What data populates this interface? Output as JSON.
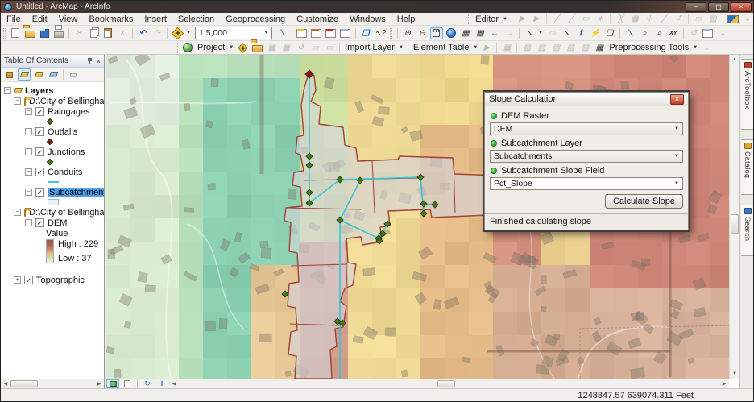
{
  "window": {
    "title": "Untitled - ArcMap - ArcInfo"
  },
  "menus": [
    "File",
    "Edit",
    "View",
    "Bookmarks",
    "Insert",
    "Selection",
    "Geoprocessing",
    "Customize",
    "Windows",
    "Help"
  ],
  "toolbars": {
    "scale": "1:5,000",
    "editor_label": "Editor",
    "project_label": "Project",
    "import_layer_label": "Import Layer",
    "element_table_label": "Element Table",
    "preprocessing_label": "Preprocessing Tools"
  },
  "icons": {
    "dropdown": "▼",
    "cut": "✂",
    "delete": "×",
    "undo": "↶",
    "redo": "↷",
    "zoom_in": "⊕",
    "zoom_out": "⊖",
    "back": "←",
    "forward": "→",
    "identify": "ℹ",
    "refresh": "↻",
    "pause": "‖",
    "play": "▶",
    "up": "▲",
    "down": "▼",
    "left": "◀",
    "right": "▶",
    "minimize": "–",
    "maximize": "▢",
    "close": "×",
    "select": "↖",
    "whats_this": "↖?",
    "asterisk": "∗",
    "sketch": "╱",
    "grid": "▦",
    "chart": "▨",
    "box": "▭",
    "rotate": "↺",
    "split": "╳",
    "move": "⊹",
    "xy": "XY",
    "find": "⌕",
    "measure": "⟍",
    "flash": "⚡",
    "bubble": "❑",
    "overflow": "⌄"
  },
  "toc": {
    "header_title": "Table Of Contents",
    "items": [
      {
        "label": "Layers",
        "level": 0,
        "expander": "minus",
        "icon": "layers"
      },
      {
        "label": "D:\\City of Bellingham_V",
        "level": 1,
        "expander": "minus",
        "icon": "folder"
      },
      {
        "label": "Raingages",
        "level": 2,
        "expander": "minus",
        "checked": true,
        "symbol": "diamond-green"
      },
      {
        "label": "Outfalls",
        "level": 2,
        "expander": "minus",
        "checked": true,
        "symbol": "diamond-red"
      },
      {
        "label": "Junctions",
        "level": 2,
        "expander": "minus",
        "checked": true,
        "symbol": "diamond-green"
      },
      {
        "label": "Conduits",
        "level": 2,
        "expander": "minus",
        "checked": true,
        "symbol": "line-cyan"
      },
      {
        "label": "Subcatchments",
        "level": 2,
        "expander": "minus",
        "checked": true,
        "symbol": "rect-blue",
        "selected": true
      },
      {
        "label": "D:\\City of Bellingham_V",
        "level": 1,
        "expander": "minus",
        "icon": "folder"
      },
      {
        "label": "DEM",
        "level": 2,
        "expander": "minus",
        "checked": true,
        "legend": true
      },
      {
        "label": "Topographic",
        "level": 1,
        "expander": "plus",
        "checked": true,
        "gap_before": 14
      }
    ],
    "legend": {
      "value_label": "Value",
      "high_label": "High : 229",
      "low_label": "Low : 37"
    }
  },
  "dialog": {
    "title": "Slope Calculation",
    "fields": [
      {
        "label": "DEM Raster",
        "value": "DEM",
        "white": false
      },
      {
        "label": "Subcatchment Layer",
        "value": "Subcatchments",
        "white": false
      },
      {
        "label": "Subcatchment Slope Field",
        "value": "Pct_Slope",
        "white": true
      }
    ],
    "button_label": "Calculate Slope",
    "status": "Finished calculating slope"
  },
  "side_tabs": [
    {
      "label": "ArcToolbox",
      "color": "#b5402f"
    },
    {
      "label": "Catalog",
      "color": "#d8a62c"
    },
    {
      "label": "Search",
      "color": "#3b78c2"
    }
  ],
  "statusbar": {
    "coordinates": "1248847.57 639074.311 Feet"
  },
  "colors": {
    "conduit": "#35c3d8",
    "junction_fill": "#4a7a14",
    "junction_stroke": "#22380a",
    "outfall_fill": "#8a150c",
    "subcatchment_stroke": "#a04335",
    "subcatchment_fill": "rgba(212,212,220,0.62)",
    "selection_highlight": "#4fa1e8",
    "dem_ramp": [
      "#7a6254",
      "#b05e4e",
      "#cc8468",
      "#e2c28e",
      "#d4e2a8",
      "#eef4e4"
    ]
  }
}
